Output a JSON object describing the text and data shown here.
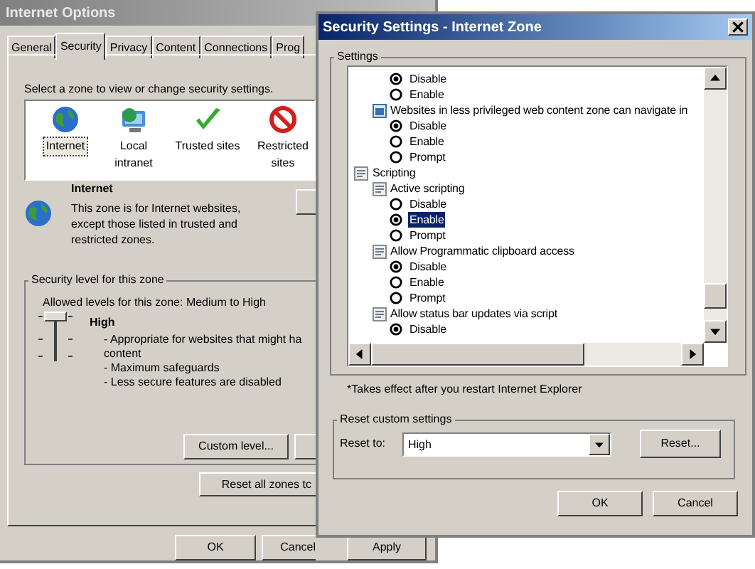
{
  "back_window": {
    "title": "Internet Options",
    "tabs": [
      {
        "label": "General",
        "selected": false
      },
      {
        "label": "Security",
        "selected": true
      },
      {
        "label": "Privacy",
        "selected": false
      },
      {
        "label": "Content",
        "selected": false
      },
      {
        "label": "Connections",
        "selected": false
      },
      {
        "label": "Prog",
        "selected": false
      }
    ],
    "zone_prompt": "Select a zone to view or change security settings.",
    "zones": [
      {
        "kind": "globe",
        "label": "Internet",
        "selected": true
      },
      {
        "kind": "intranet",
        "label": "Local intranet",
        "selected": false
      },
      {
        "kind": "trusted",
        "label": "Trusted sites",
        "selected": false
      },
      {
        "kind": "restricted",
        "label": "Restricted sites",
        "selected": false
      }
    ],
    "zone_info": {
      "title": "Internet",
      "description": "This zone is for Internet websites, except those listed in trusted and restricted zones."
    },
    "security_level": {
      "legend": "Security level for this zone",
      "allowed": "Allowed levels for this zone: Medium to High",
      "level": 1,
      "name": "High",
      "lines": [
        "- Appropriate for websites that might ha",
        "content",
        "- Maximum safeguards",
        "- Less secure features are disabled"
      ]
    },
    "custom_level_button": "Custom level...",
    "reset_all_button": "Reset all zones tc",
    "buttons": [
      "OK",
      "Cancel",
      "Apply"
    ]
  },
  "dialog": {
    "title": "Security Settings - Internet Zone",
    "settings_legend": "Settings",
    "tree": [
      {
        "kind": "group",
        "children": [
          {
            "kind": "group",
            "children": [
              {
                "kind": "option",
                "label": "Disable",
                "selected": true,
                "highlighted": false
              },
              {
                "kind": "option",
                "label": "Enable",
                "selected": false,
                "highlighted": false
              }
            ]
          },
          {
            "kind": "web-setting",
            "label": "Websites in less privileged web content zone can navigate in",
            "children": [
              {
                "kind": "option",
                "label": "Disable",
                "selected": true,
                "highlighted": false
              },
              {
                "kind": "option",
                "label": "Enable",
                "selected": false,
                "highlighted": false
              },
              {
                "kind": "option",
                "label": "Prompt",
                "selected": false,
                "highlighted": false
              }
            ]
          }
        ]
      },
      {
        "kind": "category",
        "label": "Scripting",
        "children": [
          {
            "kind": "setting",
            "label": "Active scripting",
            "children": [
              {
                "kind": "option",
                "label": "Disable",
                "selected": false,
                "highlighted": false
              },
              {
                "kind": "option",
                "label": "Enable",
                "selected": true,
                "highlighted": true
              },
              {
                "kind": "option",
                "label": "Prompt",
                "selected": false,
                "highlighted": false
              }
            ]
          },
          {
            "kind": "setting",
            "label": "Allow Programmatic clipboard access",
            "children": [
              {
                "kind": "option",
                "label": "Disable",
                "selected": true,
                "highlighted": false
              },
              {
                "kind": "option",
                "label": "Enable",
                "selected": false,
                "highlighted": false
              },
              {
                "kind": "option",
                "label": "Prompt",
                "selected": false,
                "highlighted": false
              }
            ]
          },
          {
            "kind": "setting",
            "label": "Allow status bar updates via script",
            "children": [
              {
                "kind": "option",
                "label": "Disable",
                "selected": true,
                "highlighted": false
              }
            ]
          }
        ]
      }
    ],
    "note": "*Takes effect after you restart Internet Explorer",
    "reset_legend": "Reset custom settings",
    "reset_label": "Reset to:",
    "reset_value": "High",
    "reset_button": "Reset...",
    "buttons": [
      "OK",
      "Cancel"
    ]
  }
}
